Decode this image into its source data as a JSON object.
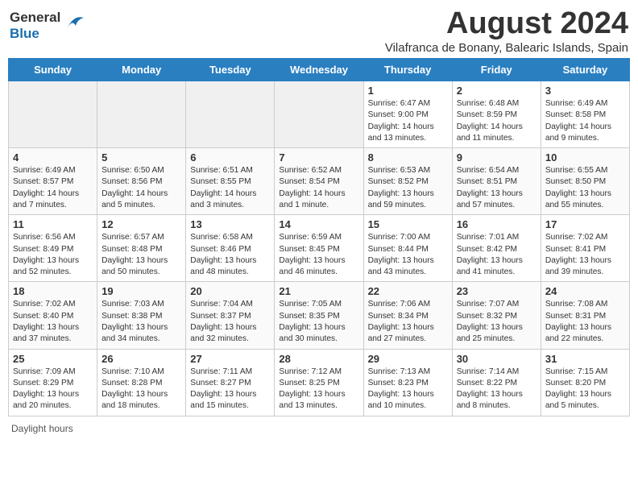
{
  "header": {
    "logo": {
      "line1": "General",
      "line2": "Blue"
    },
    "title": "August 2024",
    "subtitle": "Vilafranca de Bonany, Balearic Islands, Spain"
  },
  "calendar": {
    "headers": [
      "Sunday",
      "Monday",
      "Tuesday",
      "Wednesday",
      "Thursday",
      "Friday",
      "Saturday"
    ],
    "weeks": [
      [
        {
          "day": "",
          "info": "",
          "empty": true
        },
        {
          "day": "",
          "info": "",
          "empty": true
        },
        {
          "day": "",
          "info": "",
          "empty": true
        },
        {
          "day": "",
          "info": "",
          "empty": true
        },
        {
          "day": "1",
          "info": "Sunrise: 6:47 AM\nSunset: 9:00 PM\nDaylight: 14 hours\nand 13 minutes."
        },
        {
          "day": "2",
          "info": "Sunrise: 6:48 AM\nSunset: 8:59 PM\nDaylight: 14 hours\nand 11 minutes."
        },
        {
          "day": "3",
          "info": "Sunrise: 6:49 AM\nSunset: 8:58 PM\nDaylight: 14 hours\nand 9 minutes."
        }
      ],
      [
        {
          "day": "4",
          "info": "Sunrise: 6:49 AM\nSunset: 8:57 PM\nDaylight: 14 hours\nand 7 minutes."
        },
        {
          "day": "5",
          "info": "Sunrise: 6:50 AM\nSunset: 8:56 PM\nDaylight: 14 hours\nand 5 minutes."
        },
        {
          "day": "6",
          "info": "Sunrise: 6:51 AM\nSunset: 8:55 PM\nDaylight: 14 hours\nand 3 minutes."
        },
        {
          "day": "7",
          "info": "Sunrise: 6:52 AM\nSunset: 8:54 PM\nDaylight: 14 hours\nand 1 minute."
        },
        {
          "day": "8",
          "info": "Sunrise: 6:53 AM\nSunset: 8:52 PM\nDaylight: 13 hours\nand 59 minutes."
        },
        {
          "day": "9",
          "info": "Sunrise: 6:54 AM\nSunset: 8:51 PM\nDaylight: 13 hours\nand 57 minutes."
        },
        {
          "day": "10",
          "info": "Sunrise: 6:55 AM\nSunset: 8:50 PM\nDaylight: 13 hours\nand 55 minutes."
        }
      ],
      [
        {
          "day": "11",
          "info": "Sunrise: 6:56 AM\nSunset: 8:49 PM\nDaylight: 13 hours\nand 52 minutes."
        },
        {
          "day": "12",
          "info": "Sunrise: 6:57 AM\nSunset: 8:48 PM\nDaylight: 13 hours\nand 50 minutes."
        },
        {
          "day": "13",
          "info": "Sunrise: 6:58 AM\nSunset: 8:46 PM\nDaylight: 13 hours\nand 48 minutes."
        },
        {
          "day": "14",
          "info": "Sunrise: 6:59 AM\nSunset: 8:45 PM\nDaylight: 13 hours\nand 46 minutes."
        },
        {
          "day": "15",
          "info": "Sunrise: 7:00 AM\nSunset: 8:44 PM\nDaylight: 13 hours\nand 43 minutes."
        },
        {
          "day": "16",
          "info": "Sunrise: 7:01 AM\nSunset: 8:42 PM\nDaylight: 13 hours\nand 41 minutes."
        },
        {
          "day": "17",
          "info": "Sunrise: 7:02 AM\nSunset: 8:41 PM\nDaylight: 13 hours\nand 39 minutes."
        }
      ],
      [
        {
          "day": "18",
          "info": "Sunrise: 7:02 AM\nSunset: 8:40 PM\nDaylight: 13 hours\nand 37 minutes."
        },
        {
          "day": "19",
          "info": "Sunrise: 7:03 AM\nSunset: 8:38 PM\nDaylight: 13 hours\nand 34 minutes."
        },
        {
          "day": "20",
          "info": "Sunrise: 7:04 AM\nSunset: 8:37 PM\nDaylight: 13 hours\nand 32 minutes."
        },
        {
          "day": "21",
          "info": "Sunrise: 7:05 AM\nSunset: 8:35 PM\nDaylight: 13 hours\nand 30 minutes."
        },
        {
          "day": "22",
          "info": "Sunrise: 7:06 AM\nSunset: 8:34 PM\nDaylight: 13 hours\nand 27 minutes."
        },
        {
          "day": "23",
          "info": "Sunrise: 7:07 AM\nSunset: 8:32 PM\nDaylight: 13 hours\nand 25 minutes."
        },
        {
          "day": "24",
          "info": "Sunrise: 7:08 AM\nSunset: 8:31 PM\nDaylight: 13 hours\nand 22 minutes."
        }
      ],
      [
        {
          "day": "25",
          "info": "Sunrise: 7:09 AM\nSunset: 8:29 PM\nDaylight: 13 hours\nand 20 minutes."
        },
        {
          "day": "26",
          "info": "Sunrise: 7:10 AM\nSunset: 8:28 PM\nDaylight: 13 hours\nand 18 minutes."
        },
        {
          "day": "27",
          "info": "Sunrise: 7:11 AM\nSunset: 8:27 PM\nDaylight: 13 hours\nand 15 minutes."
        },
        {
          "day": "28",
          "info": "Sunrise: 7:12 AM\nSunset: 8:25 PM\nDaylight: 13 hours\nand 13 minutes."
        },
        {
          "day": "29",
          "info": "Sunrise: 7:13 AM\nSunset: 8:23 PM\nDaylight: 13 hours\nand 10 minutes."
        },
        {
          "day": "30",
          "info": "Sunrise: 7:14 AM\nSunset: 8:22 PM\nDaylight: 13 hours\nand 8 minutes."
        },
        {
          "day": "31",
          "info": "Sunrise: 7:15 AM\nSunset: 8:20 PM\nDaylight: 13 hours\nand 5 minutes."
        }
      ]
    ]
  },
  "footer": {
    "daylight_label": "Daylight hours"
  }
}
